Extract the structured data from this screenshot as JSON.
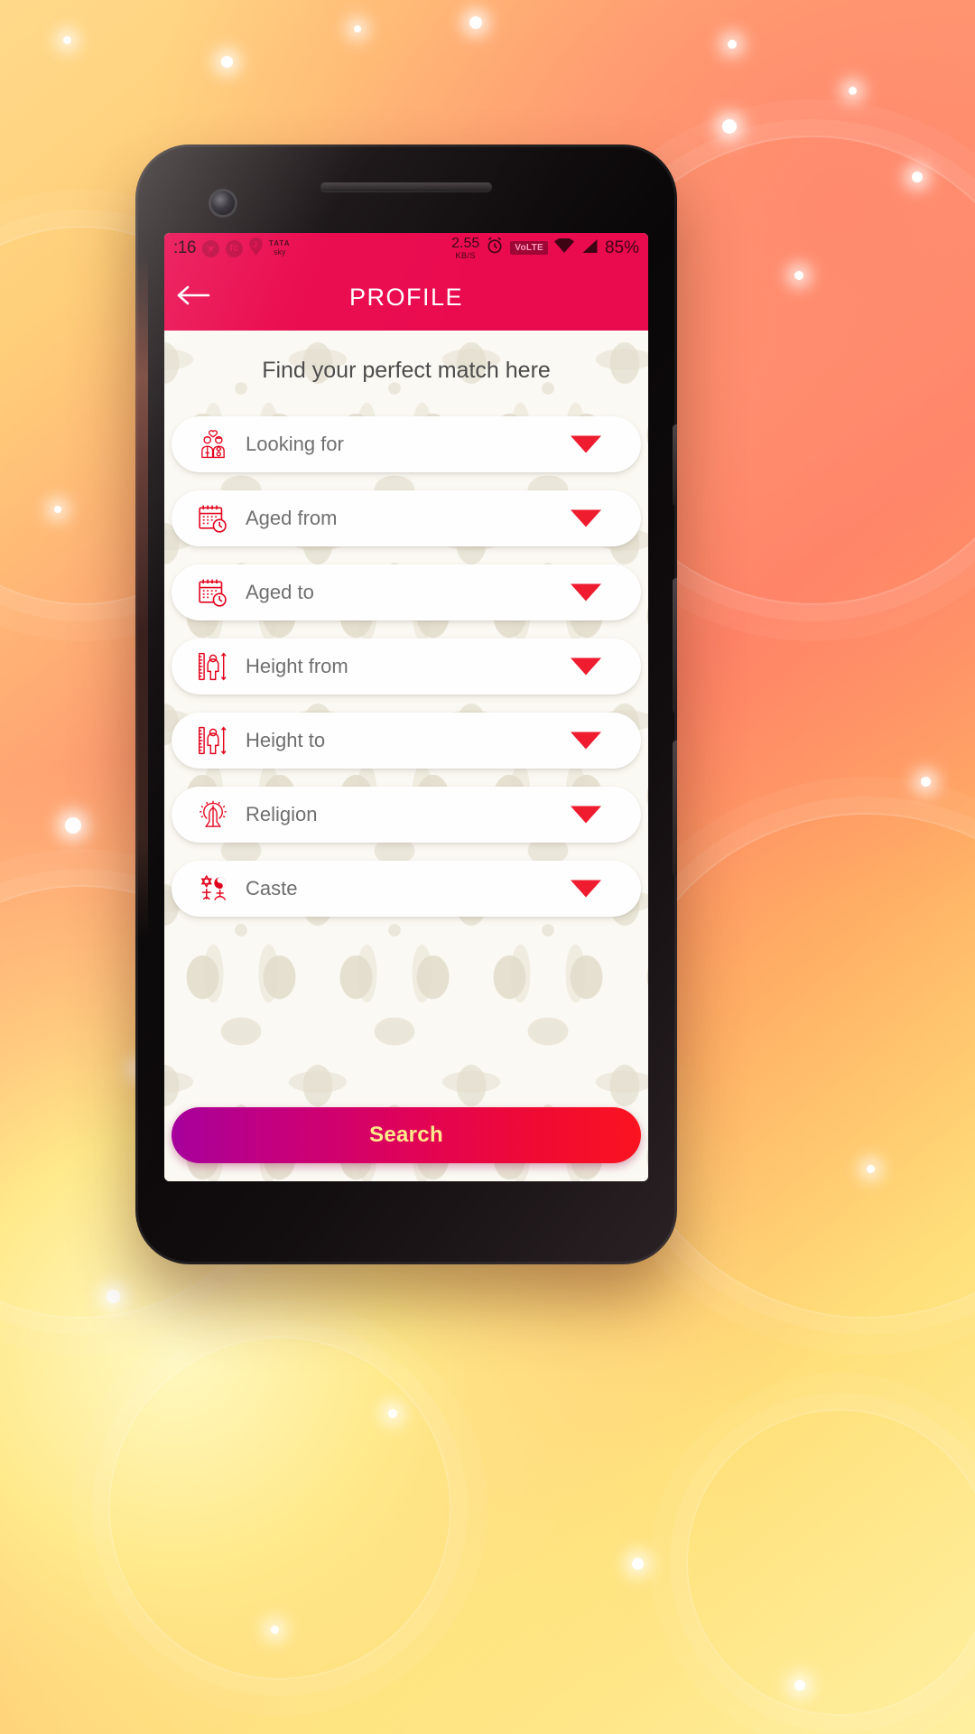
{
  "statusbar": {
    "clock": ":16",
    "app_icons": [
      "chrome-icon",
      "fc-icon",
      "swiggy-icon"
    ],
    "carrier_line1": "TATA",
    "carrier_line2": "sky",
    "net_speed_value": "2.55",
    "net_speed_unit": "KB/S",
    "alarm_icon": "alarm-icon",
    "volte_label": "VoLTE",
    "wifi_icon": "wifi-icon",
    "signal_icon": "signal-icon",
    "battery": "85%"
  },
  "appbar": {
    "back_icon": "back-arrow-icon",
    "title": "PROFILE"
  },
  "main": {
    "tagline": "Find your perfect match here",
    "fields": [
      {
        "label": "Looking for",
        "icon": "couple-heart-icon",
        "caret": "chevron-down-icon"
      },
      {
        "label": "Aged from",
        "icon": "calendar-clock-icon",
        "caret": "chevron-down-icon"
      },
      {
        "label": "Aged to",
        "icon": "calendar-clock-icon",
        "caret": "chevron-down-icon"
      },
      {
        "label": "Height from",
        "icon": "height-ruler-icon",
        "caret": "chevron-down-icon"
      },
      {
        "label": "Height to",
        "icon": "height-ruler-icon",
        "caret": "chevron-down-icon"
      },
      {
        "label": "Religion",
        "icon": "praying-hands-icon",
        "caret": "chevron-down-icon"
      },
      {
        "label": "Caste",
        "icon": "religion-symbols-icon",
        "caret": "chevron-down-icon"
      }
    ],
    "search_label": "Search"
  },
  "colors": {
    "brand_pink": "#ea0a4e",
    "caret_red": "#ef1b2e",
    "icon_red": "#e2001a",
    "search_text": "#ffe98a",
    "label_gray": "#6e6e6e"
  }
}
